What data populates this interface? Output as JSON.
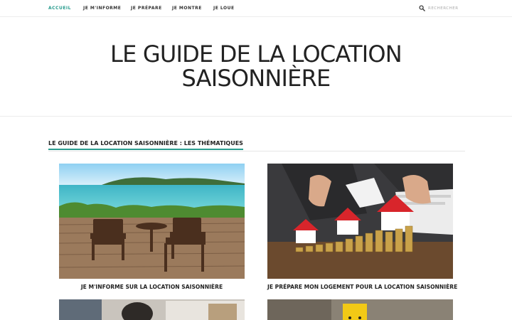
{
  "nav": {
    "items": [
      {
        "label": "ACCUEIL",
        "active": true
      },
      {
        "label": "JE M'INFORME",
        "active": false
      },
      {
        "label": "JE PRÉPARE",
        "active": false
      },
      {
        "label": "JE MONTRE",
        "active": false
      },
      {
        "label": "JE LOUE",
        "active": false
      }
    ],
    "search_placeholder": "RECHERCHER",
    "accent_color": "#2a9d8f"
  },
  "hero": {
    "title_line1": "LE GUIDE DE LA LOCATION",
    "title_line2": "SAISONNIÈRE"
  },
  "section": {
    "title": "LE GUIDE DE LA LOCATION SAISONNIÈRE : LES THÉMATIQUES"
  },
  "cards": [
    {
      "title": "JE M'INFORME SUR LA LOCATION SAISONNIÈRE",
      "image": "seaside-terrace-chairs-photo"
    },
    {
      "title": "JE PRÉPARE MON LOGEMENT POUR LA LOCATION SAISONNIÈRE",
      "image": "houses-and-coins-photo"
    },
    {
      "title": "",
      "image": "person-at-laptop-photo"
    },
    {
      "title": "",
      "image": "yellow-smiley-card-photo"
    }
  ]
}
